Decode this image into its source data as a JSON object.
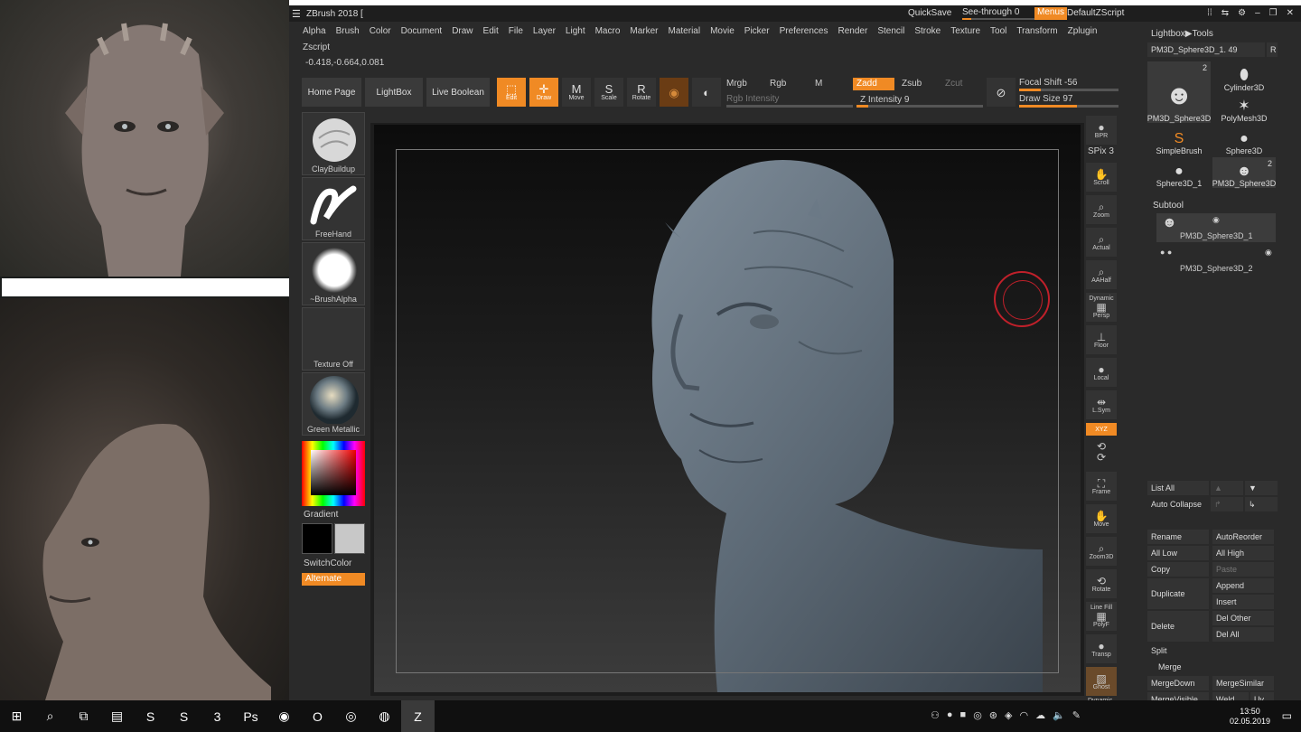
{
  "app": {
    "title": "ZBrush 2018 [",
    "quicksave": "QuickSave",
    "see_through": "See-through  0",
    "menus": "Menus",
    "default_zscript": "DefaultZScript"
  },
  "menubar": [
    "Alpha",
    "Brush",
    "Color",
    "Document",
    "Draw",
    "Edit",
    "File",
    "Layer",
    "Light",
    "Macro",
    "Marker",
    "Material",
    "Movie",
    "Picker",
    "Preferences",
    "Render",
    "Stencil",
    "Stroke",
    "Texture",
    "Tool",
    "Transform",
    "Zplugin",
    "Zscript"
  ],
  "coords": "-0.418,-0.664,0.081",
  "shelf": {
    "home_page": "Home Page",
    "lightbox": "LightBox",
    "live_boolean": "Live Boolean",
    "edit": "Edit",
    "draw": "Draw",
    "move": "Move",
    "scale": "Scale",
    "rotate": "Rotate",
    "mrgb": "Mrgb",
    "rgb": "Rgb",
    "m": "M",
    "rgb_intensity": "Rgb Intensity",
    "zadd": "Zadd",
    "zsub": "Zsub",
    "zcut": "Zcut",
    "z_intensity": "Z Intensity 9",
    "z_intensity_value": 9,
    "focal_shift": "Focal Shift -56",
    "focal_shift_value": -56,
    "draw_size": "Draw Size 97",
    "draw_size_value": 97
  },
  "left_shelf": {
    "brush": "ClayBuildup",
    "stroke": "FreeHand",
    "alpha": "~BrushAlpha",
    "texture": "Texture Off",
    "material": "Green Metallic",
    "gradient": "Gradient",
    "switch_color": "SwitchColor",
    "alternate": "Alternate"
  },
  "right_shelf": {
    "bpr": "BPR",
    "spix": "SPix 3",
    "scroll": "Scroll",
    "zoom": "Zoom",
    "actual": "Actual",
    "aahalf": "AAHalf",
    "dynamic": "Dynamic",
    "persp": "Persp",
    "floor": "Floor",
    "local": "Local",
    "lsym": "L.Sym",
    "xyz": "XYZ",
    "frame": "Frame",
    "move": "Move",
    "zoom3d": "Zoom3D",
    "rotate": "Rotate",
    "line_fill": "Line Fill",
    "polyf": "PolyF",
    "transp": "Transp",
    "ghost": "Ghost",
    "dynamic_bottom": "Dynamic"
  },
  "tray": {
    "header": "Lightbox▶Tools",
    "current_tool": "PM3D_Sphere3D_1. 49",
    "r": "R",
    "tools": [
      {
        "name": "PM3D_Sphere3D",
        "count": "2",
        "icon": "☻"
      },
      {
        "name": "Cylinder3D",
        "count": "",
        "icon": "⬮"
      },
      {
        "name": "PolyMesh3D",
        "count": "",
        "icon": "✶"
      },
      {
        "name": "SimpleBrush",
        "count": "",
        "icon": "S"
      },
      {
        "name": "Sphere3D",
        "count": "",
        "icon": "●"
      },
      {
        "name": "Sphere3D_1",
        "count": "",
        "icon": "●"
      },
      {
        "name": "PM3D_Sphere3D",
        "count": "2",
        "icon": "☻"
      }
    ],
    "subtool_header": "Subtool",
    "subtools": [
      "PM3D_Sphere3D_1",
      "PM3D_Sphere3D_2"
    ],
    "list_all": "List All",
    "auto_collapse": "Auto Collapse",
    "rename": "Rename",
    "auto_reorder": "AutoReorder",
    "all_low": "All Low",
    "all_high": "All High",
    "copy": "Copy",
    "paste": "Paste",
    "duplicate": "Duplicate",
    "append": "Append",
    "insert": "Insert",
    "delete": "Delete",
    "del_other": "Del Other",
    "del_all": "Del All",
    "split": "Split",
    "merge": "Merge",
    "merge_down": "MergeDown",
    "merge_similar": "MergeSimilar",
    "merge_visible": "MergeVisible",
    "weld": "Weld",
    "uv": "Uv"
  },
  "taskbar": {
    "time": "13:50",
    "date": "02.05.2019",
    "icons": [
      "windows-icon",
      "search-icon",
      "task-view-icon",
      "explorer-icon",
      "solidworks-icon",
      "app-s-icon",
      "app-3-icon",
      "photoshop-icon",
      "chrome-icon",
      "opera-icon",
      "spotify-icon",
      "obs-icon",
      "zbrush-icon"
    ],
    "icon_glyphs": [
      "⊞",
      "⌕",
      "⧉",
      "▤",
      "S",
      "S",
      "3",
      "Ps",
      "◉",
      "O",
      "◎",
      "◍",
      "Z"
    ]
  },
  "colors": {
    "accent": "#f08a24",
    "panel": "#2a2a2a",
    "cursor": "#c0202a"
  }
}
